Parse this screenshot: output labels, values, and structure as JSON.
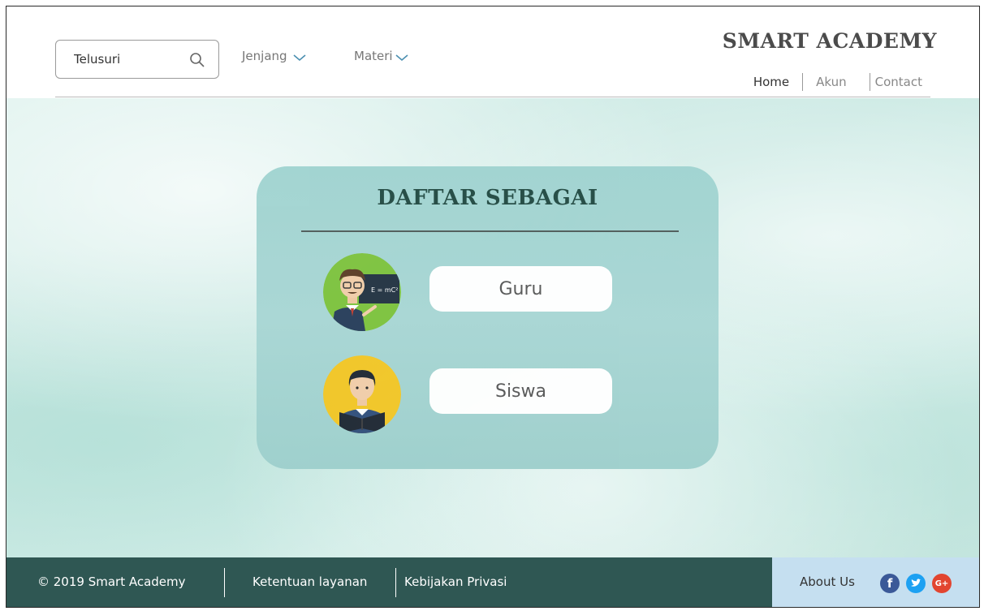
{
  "header": {
    "search": {
      "placeholder": "Telusuri"
    },
    "nav": [
      {
        "label": "Jenjang"
      },
      {
        "label": "Materi"
      }
    ],
    "brand": "SMART ACADEMY",
    "links": [
      {
        "label": "Home"
      },
      {
        "label": "Akun"
      },
      {
        "label": "Contact"
      }
    ]
  },
  "card": {
    "title": "DAFTAR SEBAGAI",
    "roles": [
      {
        "label": "Guru",
        "icon": "teacher-avatar-icon",
        "board_text": "E = mC²"
      },
      {
        "label": "Siswa",
        "icon": "student-avatar-icon"
      }
    ]
  },
  "footer": {
    "copyright": "© 2019 Smart Academy",
    "terms": "Ketentuan layanan",
    "privacy": "Kebijakan Privasi",
    "about": "About Us",
    "social": [
      {
        "name": "facebook-icon",
        "glyph": "f",
        "color": "#3b5998"
      },
      {
        "name": "twitter-icon",
        "glyph": "t",
        "color": "#1da1f2"
      },
      {
        "name": "google-plus-icon",
        "glyph": "G+",
        "color": "#e24530"
      }
    ]
  },
  "colors": {
    "footer_bg": "#2f5753",
    "footer_right_bg": "#c5dff0",
    "card_bg": "#a3d4d2",
    "title_color": "#1f4740"
  }
}
